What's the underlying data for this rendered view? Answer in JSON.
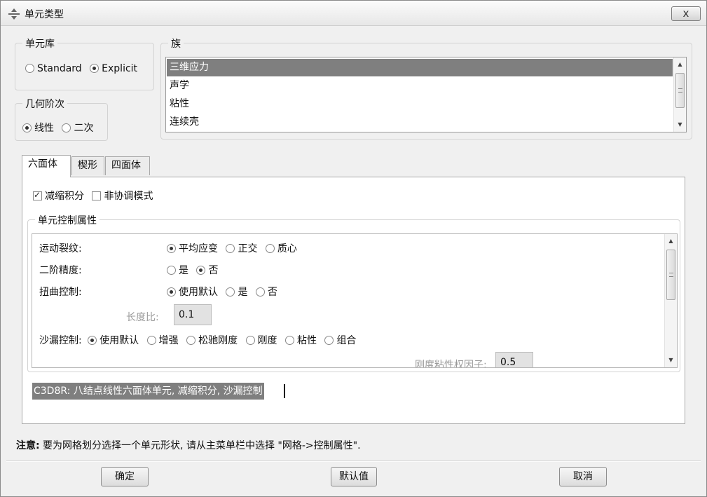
{
  "window": {
    "title": "单元类型",
    "close_symbol": "x"
  },
  "element_library": {
    "label": "单元库",
    "options": [
      "Standard",
      "Explicit"
    ],
    "selected": "Explicit"
  },
  "geometric_order": {
    "label": "几何阶次",
    "options": [
      "线性",
      "二次"
    ],
    "selected": "线性"
  },
  "family": {
    "label": "族",
    "items": [
      "三维应力",
      "声学",
      "粘性",
      "连续壳"
    ],
    "selected": "三维应力"
  },
  "tabs": [
    {
      "label": "六面体",
      "active": true
    },
    {
      "label": "楔形",
      "active": false
    },
    {
      "label": "四面体",
      "active": false
    }
  ],
  "options": {
    "reduced_integration": {
      "label": "减缩积分",
      "checked": true
    },
    "incompatible_modes": {
      "label": "非协调模式",
      "checked": false
    }
  },
  "controls": {
    "label": "单元控制属性",
    "kinematic_split": {
      "label": "运动裂纹:",
      "options": [
        "平均应变",
        "正交",
        "质心"
      ],
      "selected": "平均应变"
    },
    "second_order_accuracy": {
      "label": "二阶精度:",
      "options": [
        "是",
        "否"
      ],
      "selected": "否"
    },
    "distortion_control": {
      "label": "扭曲控制:",
      "options": [
        "使用默认",
        "是",
        "否"
      ],
      "selected": "使用默认"
    },
    "length_ratio": {
      "label": "长度比:",
      "value": "0.1"
    },
    "hourglass_control": {
      "label": "沙漏控制:",
      "options": [
        "使用默认",
        "增强",
        "松驰刚度",
        "刚度",
        "粘性",
        "组合"
      ],
      "selected": "使用默认"
    },
    "stiffness_viscosity_weight": {
      "label": "刚度粘性权因子:",
      "value": "0.5"
    }
  },
  "description": "C3D8R:  八结点线性六面体单元, 减缩积分, 沙漏控制",
  "note": {
    "label": "注意:",
    "text": " 要为网格划分选择一个单元形状, 请从主菜单栏中选择 \"网格->控制属性\"."
  },
  "buttons": {
    "ok": "确定",
    "defaults": "默认值",
    "cancel": "取消"
  }
}
